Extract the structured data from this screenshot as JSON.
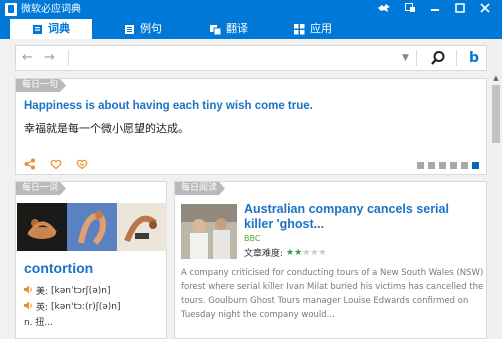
{
  "window": {
    "title": "微软必应词典",
    "controls": [
      "bird-icon",
      "minimize-to-tray-icon",
      "minimize-icon",
      "maximize-icon",
      "close-icon"
    ]
  },
  "nav": {
    "tabs": [
      {
        "label": "词典",
        "icon": "book-icon",
        "active": true
      },
      {
        "label": "例句",
        "icon": "notebook-icon",
        "active": false
      },
      {
        "label": "翻译",
        "icon": "translate-icon",
        "active": false
      },
      {
        "label": "应用",
        "icon": "apps-icon",
        "active": false
      }
    ]
  },
  "search": {
    "back": "←",
    "forward": "→",
    "placeholder": "",
    "value": "",
    "dropdown": "▼",
    "bing": "b"
  },
  "daily_sentence": {
    "tag": "每日一句",
    "english": "Happiness is about having each tiny wish come true.",
    "chinese": "幸福就是每一个微小愿望的达成。",
    "pager": {
      "count": 6,
      "active_index": 5
    }
  },
  "daily_word": {
    "tag": "每日一词",
    "word": "contortion",
    "pron_us_label": "美:",
    "pron_us": "[kənˈtɔrʃ(ə)n]",
    "pron_uk_label": "英:",
    "pron_uk": "[kən'tɔː(r)ʃ(ə)n]",
    "definition": "n. 扭..."
  },
  "daily_reading": {
    "tag": "每日阅读",
    "title": "Australian company cancels serial killer 'ghost...",
    "source": "BBC",
    "difficulty_label": "文章难度:",
    "difficulty": 2,
    "difficulty_max": 5,
    "body": "A company criticised for conducting tours of a New South Wales (NSW) forest where serial killer Ivan Milat buried his victims has cancelled the tours. Goulburn Ghost Tours manager Louise Edwards confirmed on Tuesday night the company would..."
  },
  "colors": {
    "accent": "#0078d7",
    "link": "#1a73c4",
    "orange": "#e8912a",
    "green": "#3b9a3b"
  }
}
